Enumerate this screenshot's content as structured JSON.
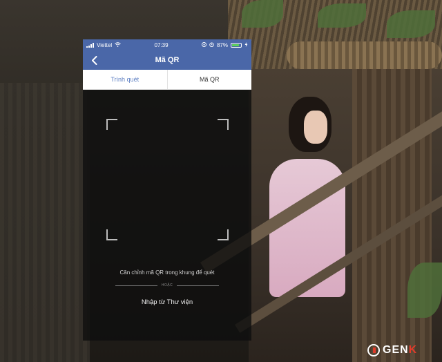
{
  "status_bar": {
    "carrier": "Viettel",
    "time": "07:39",
    "battery_percent": "87%",
    "battery_level": 0.87
  },
  "header": {
    "title": "Mã QR"
  },
  "tabs": [
    {
      "label": "Trình quét",
      "active": true
    },
    {
      "label": "Mã QR",
      "active": false
    }
  ],
  "scanner": {
    "hint": "Căn chỉnh mã QR trong khung để quét",
    "or_label": "HOẶC",
    "import_label": "Nhập từ Thư viện"
  },
  "watermark": {
    "brand_prefix": "GEN",
    "brand_suffix": "K"
  },
  "colors": {
    "navbar": "#4a67a8",
    "active_tab": "#5b7ec2",
    "battery": "#5fd35a",
    "brand_accent": "#e23b2a"
  },
  "icons": [
    "back-chevron-icon",
    "wifi-icon",
    "location-icon",
    "alarm-icon",
    "battery-icon",
    "signal-icon",
    "charging-icon"
  ]
}
